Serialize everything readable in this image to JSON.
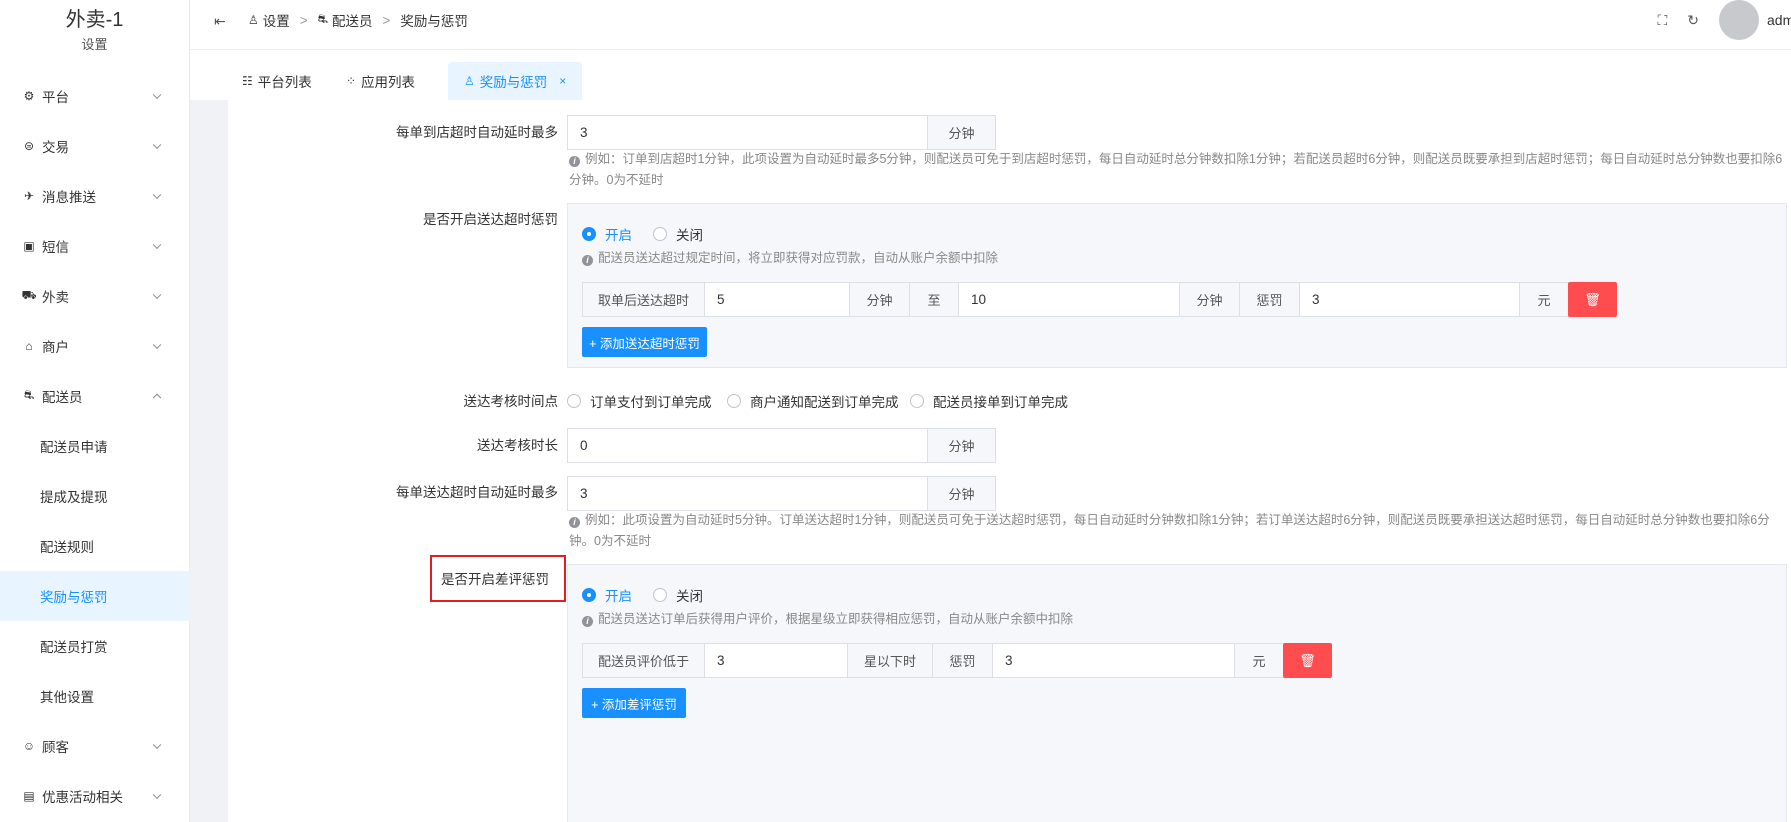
{
  "brand": {
    "title": "外卖-1",
    "subtitle": "设置"
  },
  "header": {
    "breadcrumbs": [
      "设置",
      "配送员",
      "奖励与惩罚"
    ],
    "user": "admin"
  },
  "tabs": [
    {
      "label": "平台列表",
      "icon": "list-icon"
    },
    {
      "label": "应用列表",
      "icon": "apps-icon"
    },
    {
      "label": "奖励与惩罚",
      "icon": "user-icon",
      "closable": true
    }
  ],
  "sidebar": {
    "items": [
      {
        "label": "平台",
        "icon": "gear-icon"
      },
      {
        "label": "交易",
        "icon": "trade-icon"
      },
      {
        "label": "消息推送",
        "icon": "push-icon"
      },
      {
        "label": "短信",
        "icon": "sms-icon"
      },
      {
        "label": "外卖",
        "icon": "delivery-icon"
      },
      {
        "label": "商户",
        "icon": "shop-icon"
      },
      {
        "label": "配送员",
        "icon": "courier-icon",
        "expanded": true
      }
    ],
    "sub_items": [
      "配送员申请",
      "提成及提现",
      "配送规则",
      "奖励与惩罚",
      "配送员打赏",
      "其他设置"
    ],
    "items_after": [
      {
        "label": "顾客",
        "icon": "customer-icon"
      },
      {
        "label": "优惠活动相关",
        "icon": "gift-icon"
      }
    ]
  },
  "form": {
    "store_delay": {
      "label": "每单到店超时自动延时最多",
      "value": "3",
      "unit": "分钟",
      "tip": "例如：订单到店超时1分钟，此项设置为自动延时最多5分钟，则配送员可免于到店超时惩罚，每日自动延时总分钟数扣除1分钟；若配送员超时6分钟，则配送员既要承担到店超时惩罚；每日自动延时总分钟数也要扣除6分钟。0为不延时"
    },
    "delivery_penalty": {
      "label": "是否开启送达超时惩罚",
      "on": "开启",
      "off": "关闭",
      "tip": "配送员送达超过规定时间，将立即获得对应罚款，自动从账户余额中扣除",
      "row": {
        "prefix": "取单后送达超时",
        "from": "5",
        "unit1": "分钟",
        "to_label": "至",
        "to": "10",
        "unit2": "分钟",
        "penalty_label": "惩罚",
        "amount": "3",
        "currency": "元"
      },
      "add_button": "+ 添加送达超时惩罚"
    },
    "check_point": {
      "label": "送达考核时间点",
      "options": [
        "订单支付到订单完成",
        "商户通知配送到订单完成",
        "配送员接单到订单完成"
      ]
    },
    "check_duration": {
      "label": "送达考核时长",
      "value": "0",
      "unit": "分钟"
    },
    "delivery_delay": {
      "label": "每单送达超时自动延时最多",
      "value": "3",
      "unit": "分钟",
      "tip": "例如：此项设置为自动延时5分钟。订单送达超时1分钟，则配送员可免于送达超时惩罚，每日自动延时分钟数扣除1分钟；若订单送达超时6分钟，则配送员既要承担送达超时惩罚，每日自动延时总分钟数也要扣除6分钟。0为不延时"
    },
    "bad_review": {
      "label": "是否开启差评惩罚",
      "on": "开启",
      "off": "关闭",
      "tip": "配送员送达订单后获得用户评价，根据星级立即获得相应惩罚，自动从账户余额中扣除",
      "row": {
        "prefix": "配送员评价低于",
        "stars": "3",
        "stars_suffix": "星以下时",
        "penalty_label": "惩罚",
        "amount": "3",
        "currency": "元"
      },
      "add_button": "+ 添加差评惩罚"
    }
  },
  "colors": {
    "primary": "#1890ff",
    "danger": "#ff4d4f",
    "highlight": "#e02020"
  }
}
